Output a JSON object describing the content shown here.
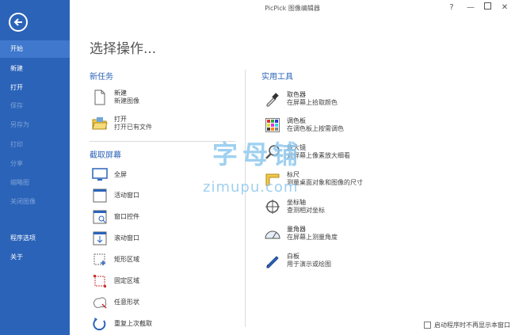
{
  "window": {
    "title": "PicPick 图像编辑器"
  },
  "sidebar": {
    "items": [
      {
        "label": "开始",
        "state": "active"
      },
      {
        "label": "新建",
        "state": "normal"
      },
      {
        "label": "打开",
        "state": "normal"
      },
      {
        "label": "保存",
        "state": "disabled"
      },
      {
        "label": "另存为",
        "state": "disabled"
      },
      {
        "label": "打印",
        "state": "disabled"
      },
      {
        "label": "分享",
        "state": "disabled"
      },
      {
        "label": "缩略图",
        "state": "disabled"
      },
      {
        "label": "关闭图像",
        "state": "disabled"
      },
      {
        "label": "程序选项",
        "state": "normal"
      },
      {
        "label": "关于",
        "state": "normal"
      }
    ]
  },
  "main": {
    "heading": "选择操作...",
    "new_task": {
      "title": "新任务",
      "items": [
        {
          "label": "新建",
          "sub": "新建图像",
          "icon": "new-file-icon"
        },
        {
          "label": "打开",
          "sub": "打开已有文件",
          "icon": "open-folder-icon"
        }
      ]
    },
    "capture": {
      "title": "截取屏幕",
      "items": [
        {
          "label": "全屏",
          "icon": "monitor-icon"
        },
        {
          "label": "活动窗口",
          "icon": "window-icon"
        },
        {
          "label": "窗口控件",
          "icon": "window-control-icon"
        },
        {
          "label": "滚动窗口",
          "icon": "scroll-window-icon"
        },
        {
          "label": "矩形区域",
          "icon": "rect-region-icon"
        },
        {
          "label": "固定区域",
          "icon": "fixed-region-icon"
        },
        {
          "label": "任意形状",
          "icon": "freehand-icon"
        },
        {
          "label": "重复上次截取",
          "icon": "repeat-icon"
        }
      ]
    },
    "tools": {
      "title": "实用工具",
      "items": [
        {
          "label": "取色器",
          "sub": "在屏幕上拾取颜色",
          "icon": "eyedropper-icon"
        },
        {
          "label": "调色板",
          "sub": "在调色板上按需调色",
          "icon": "palette-icon"
        },
        {
          "label": "放大镜",
          "sub": "对屏幕上像素放大细看",
          "icon": "magnifier-icon"
        },
        {
          "label": "标尺",
          "sub": "测量桌面对象和图像的尺寸",
          "icon": "ruler-icon"
        },
        {
          "label": "坐标轴",
          "sub": "查测相对坐标",
          "icon": "crosshair-icon"
        },
        {
          "label": "量角器",
          "sub": "在屏幕上测量角度",
          "icon": "protractor-icon"
        },
        {
          "label": "白板",
          "sub": "用于演示或绘图",
          "icon": "whiteboard-icon"
        }
      ]
    }
  },
  "footer": {
    "startup_label": "启动程序时不再显示本窗口",
    "startup_checked": false
  },
  "watermark": {
    "line1": "字母铺",
    "line2": "zimupu.com"
  },
  "colors": {
    "sidebar": "#2b63b8",
    "sidebar_active": "#3f78cc",
    "accent": "#2b63b8"
  }
}
